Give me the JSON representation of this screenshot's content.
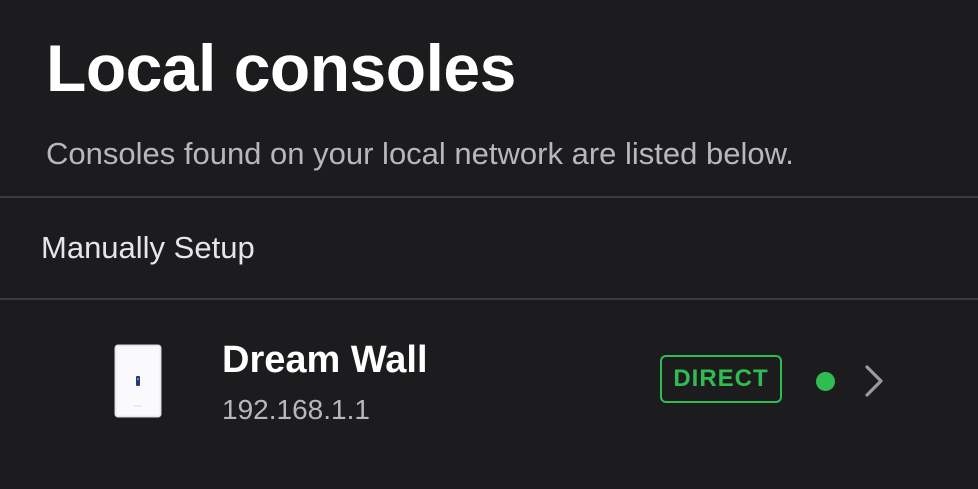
{
  "header": {
    "title": "Local consoles",
    "subtitle": "Consoles found on your local network are listed below."
  },
  "manual_setup": {
    "label": "Manually Setup"
  },
  "consoles": [
    {
      "name": "Dream Wall",
      "ip": "192.168.1.1",
      "badge": "DIRECT",
      "status": "online",
      "icon": "dream-wall-device-icon"
    }
  ],
  "colors": {
    "background": "#1c1c1e",
    "divider": "#3a3a3d",
    "badge_green": "#2fbd52",
    "status_green": "#2fbd52",
    "secondary_text": "#b7b7bc",
    "chevron": "#9a9aa0"
  }
}
